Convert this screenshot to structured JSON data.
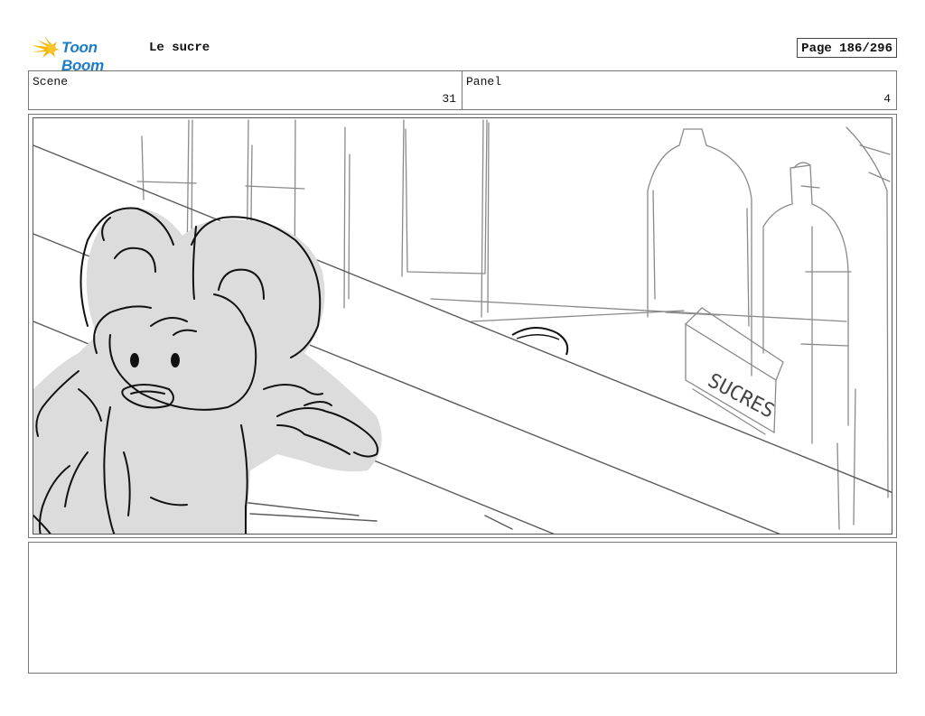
{
  "header": {
    "logo_text": "Toon Boom",
    "title": "Le sucre",
    "page": "Page 186/296"
  },
  "scene": {
    "label": "Scene",
    "value": "31"
  },
  "panel": {
    "label": "Panel",
    "value": "4"
  },
  "drawing": {
    "sign_text": "SUCRES"
  },
  "notes": {
    "text": ""
  },
  "colors": {
    "logo_blue": "#1e7bc8",
    "logo_yellow": "#f5b400",
    "fill_gray": "#dcdcdc",
    "line": "#222222"
  }
}
